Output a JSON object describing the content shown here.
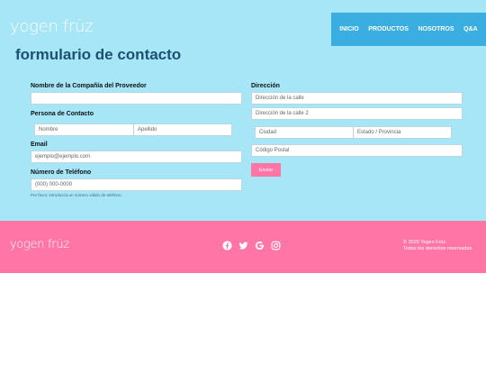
{
  "header": {
    "logo_text": "yogen früz",
    "nav": {
      "inicio": "INICIO",
      "productos": "PRODUCTOS",
      "nosotros": "NOSOTROS",
      "qa": "Q&A"
    }
  },
  "form": {
    "title": "formulario de contacto",
    "company": {
      "label": "Nombre de la Compañía del Proveedor",
      "placeholder": ""
    },
    "contact": {
      "label": "Persona de Contacto",
      "first_placeholder": "Nombre",
      "last_placeholder": "Apellido"
    },
    "email": {
      "label": "Email",
      "placeholder": "ejemplo@ejemplo.com"
    },
    "phone": {
      "label": "Número de Teléfono",
      "placeholder": "(000) 000-0000",
      "help": "Por favor, introduzca un número válido de teléfono."
    },
    "address": {
      "label": "Dirección",
      "street_placeholder": "Dirección de la calle",
      "street2_placeholder": "Dirección de la calle 2",
      "city_placeholder": "Ciudad",
      "state_placeholder": "Estado / Provincia",
      "zip_placeholder": "Código Postal"
    },
    "submit_label": "Enviar"
  },
  "footer": {
    "logo_text": "yogen früz",
    "social_icons": [
      "facebook-icon",
      "twitter-icon",
      "google-icon",
      "instagram-icon"
    ],
    "copyright_line1": "© 2025 Yogen Früz",
    "copyright_line2": "Todos los derechos reservados."
  },
  "colors": {
    "background": "#a6e6f7",
    "nav_background": "#3aaee0",
    "accent_pink": "#ff76a6",
    "title_blue": "#1d4f73"
  }
}
